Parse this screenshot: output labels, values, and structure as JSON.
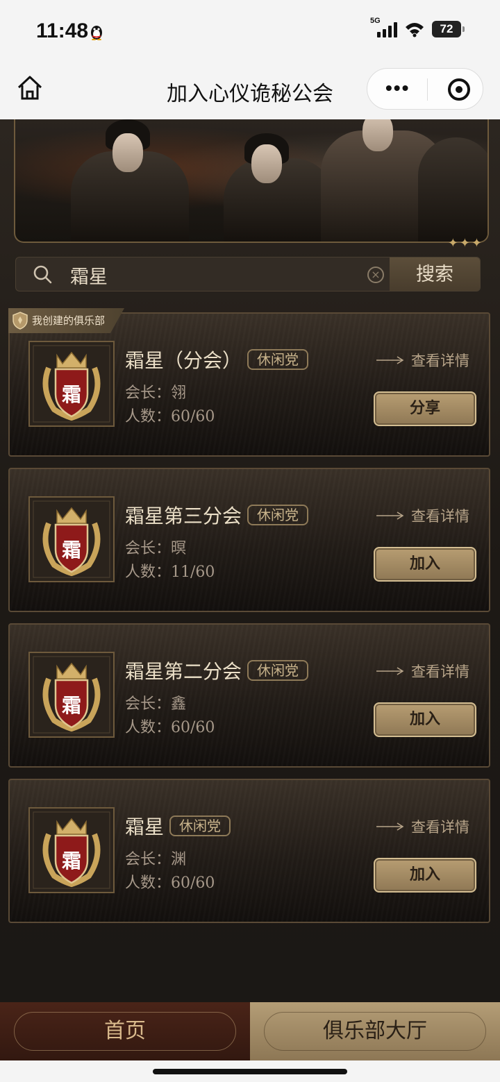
{
  "status": {
    "time": "11:48",
    "network": "5G",
    "battery": "72"
  },
  "nav": {
    "title": "加入心仪诡秘公会"
  },
  "search": {
    "value": "霜星",
    "button": "搜索"
  },
  "created_label": "我创建的俱乐部",
  "details_label": "查看详情",
  "clubs": [
    {
      "name": "霜星（分会）",
      "tag": "休闲党",
      "leader": "会长：翎",
      "members": "人数：60/60",
      "action": "分享",
      "emblem_char": "霜"
    },
    {
      "name": "霜星第三分会",
      "tag": "休闲党",
      "leader": "会长：暝",
      "members": "人数：11/60",
      "action": "加入",
      "emblem_char": "霜"
    },
    {
      "name": "霜星第二分会",
      "tag": "休闲党",
      "leader": "会长：鑫",
      "members": "人数：60/60",
      "action": "加入",
      "emblem_char": "霜"
    },
    {
      "name": "霜星",
      "tag": "休闲党",
      "leader": "会长：渊",
      "members": "人数：60/60",
      "action": "加入",
      "emblem_char": "霜"
    }
  ],
  "tabs": {
    "home": "首页",
    "lobby": "俱乐部大厅"
  },
  "colors": {
    "gold": "#b79d72",
    "crest_red": "#8e1a1a",
    "panel_dark": "#1d1915"
  }
}
